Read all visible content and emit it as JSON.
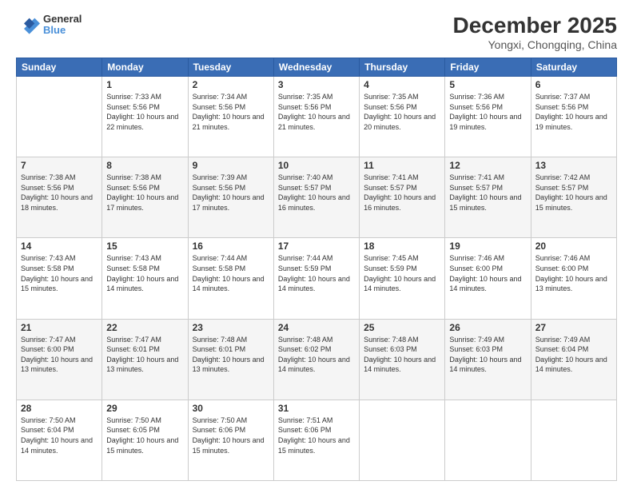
{
  "header": {
    "logo": {
      "line1": "General",
      "line2": "Blue"
    },
    "title": "December 2025",
    "location": "Yongxi, Chongqing, China"
  },
  "weekdays": [
    "Sunday",
    "Monday",
    "Tuesday",
    "Wednesday",
    "Thursday",
    "Friday",
    "Saturday"
  ],
  "weeks": [
    [
      {
        "date": "",
        "sunrise": "",
        "sunset": "",
        "daylight": ""
      },
      {
        "date": "1",
        "sunrise": "Sunrise: 7:33 AM",
        "sunset": "Sunset: 5:56 PM",
        "daylight": "Daylight: 10 hours and 22 minutes."
      },
      {
        "date": "2",
        "sunrise": "Sunrise: 7:34 AM",
        "sunset": "Sunset: 5:56 PM",
        "daylight": "Daylight: 10 hours and 21 minutes."
      },
      {
        "date": "3",
        "sunrise": "Sunrise: 7:35 AM",
        "sunset": "Sunset: 5:56 PM",
        "daylight": "Daylight: 10 hours and 21 minutes."
      },
      {
        "date": "4",
        "sunrise": "Sunrise: 7:35 AM",
        "sunset": "Sunset: 5:56 PM",
        "daylight": "Daylight: 10 hours and 20 minutes."
      },
      {
        "date": "5",
        "sunrise": "Sunrise: 7:36 AM",
        "sunset": "Sunset: 5:56 PM",
        "daylight": "Daylight: 10 hours and 19 minutes."
      },
      {
        "date": "6",
        "sunrise": "Sunrise: 7:37 AM",
        "sunset": "Sunset: 5:56 PM",
        "daylight": "Daylight: 10 hours and 19 minutes."
      }
    ],
    [
      {
        "date": "7",
        "sunrise": "Sunrise: 7:38 AM",
        "sunset": "Sunset: 5:56 PM",
        "daylight": "Daylight: 10 hours and 18 minutes."
      },
      {
        "date": "8",
        "sunrise": "Sunrise: 7:38 AM",
        "sunset": "Sunset: 5:56 PM",
        "daylight": "Daylight: 10 hours and 17 minutes."
      },
      {
        "date": "9",
        "sunrise": "Sunrise: 7:39 AM",
        "sunset": "Sunset: 5:56 PM",
        "daylight": "Daylight: 10 hours and 17 minutes."
      },
      {
        "date": "10",
        "sunrise": "Sunrise: 7:40 AM",
        "sunset": "Sunset: 5:57 PM",
        "daylight": "Daylight: 10 hours and 16 minutes."
      },
      {
        "date": "11",
        "sunrise": "Sunrise: 7:41 AM",
        "sunset": "Sunset: 5:57 PM",
        "daylight": "Daylight: 10 hours and 16 minutes."
      },
      {
        "date": "12",
        "sunrise": "Sunrise: 7:41 AM",
        "sunset": "Sunset: 5:57 PM",
        "daylight": "Daylight: 10 hours and 15 minutes."
      },
      {
        "date": "13",
        "sunrise": "Sunrise: 7:42 AM",
        "sunset": "Sunset: 5:57 PM",
        "daylight": "Daylight: 10 hours and 15 minutes."
      }
    ],
    [
      {
        "date": "14",
        "sunrise": "Sunrise: 7:43 AM",
        "sunset": "Sunset: 5:58 PM",
        "daylight": "Daylight: 10 hours and 15 minutes."
      },
      {
        "date": "15",
        "sunrise": "Sunrise: 7:43 AM",
        "sunset": "Sunset: 5:58 PM",
        "daylight": "Daylight: 10 hours and 14 minutes."
      },
      {
        "date": "16",
        "sunrise": "Sunrise: 7:44 AM",
        "sunset": "Sunset: 5:58 PM",
        "daylight": "Daylight: 10 hours and 14 minutes."
      },
      {
        "date": "17",
        "sunrise": "Sunrise: 7:44 AM",
        "sunset": "Sunset: 5:59 PM",
        "daylight": "Daylight: 10 hours and 14 minutes."
      },
      {
        "date": "18",
        "sunrise": "Sunrise: 7:45 AM",
        "sunset": "Sunset: 5:59 PM",
        "daylight": "Daylight: 10 hours and 14 minutes."
      },
      {
        "date": "19",
        "sunrise": "Sunrise: 7:46 AM",
        "sunset": "Sunset: 6:00 PM",
        "daylight": "Daylight: 10 hours and 14 minutes."
      },
      {
        "date": "20",
        "sunrise": "Sunrise: 7:46 AM",
        "sunset": "Sunset: 6:00 PM",
        "daylight": "Daylight: 10 hours and 13 minutes."
      }
    ],
    [
      {
        "date": "21",
        "sunrise": "Sunrise: 7:47 AM",
        "sunset": "Sunset: 6:00 PM",
        "daylight": "Daylight: 10 hours and 13 minutes."
      },
      {
        "date": "22",
        "sunrise": "Sunrise: 7:47 AM",
        "sunset": "Sunset: 6:01 PM",
        "daylight": "Daylight: 10 hours and 13 minutes."
      },
      {
        "date": "23",
        "sunrise": "Sunrise: 7:48 AM",
        "sunset": "Sunset: 6:01 PM",
        "daylight": "Daylight: 10 hours and 13 minutes."
      },
      {
        "date": "24",
        "sunrise": "Sunrise: 7:48 AM",
        "sunset": "Sunset: 6:02 PM",
        "daylight": "Daylight: 10 hours and 14 minutes."
      },
      {
        "date": "25",
        "sunrise": "Sunrise: 7:48 AM",
        "sunset": "Sunset: 6:03 PM",
        "daylight": "Daylight: 10 hours and 14 minutes."
      },
      {
        "date": "26",
        "sunrise": "Sunrise: 7:49 AM",
        "sunset": "Sunset: 6:03 PM",
        "daylight": "Daylight: 10 hours and 14 minutes."
      },
      {
        "date": "27",
        "sunrise": "Sunrise: 7:49 AM",
        "sunset": "Sunset: 6:04 PM",
        "daylight": "Daylight: 10 hours and 14 minutes."
      }
    ],
    [
      {
        "date": "28",
        "sunrise": "Sunrise: 7:50 AM",
        "sunset": "Sunset: 6:04 PM",
        "daylight": "Daylight: 10 hours and 14 minutes."
      },
      {
        "date": "29",
        "sunrise": "Sunrise: 7:50 AM",
        "sunset": "Sunset: 6:05 PM",
        "daylight": "Daylight: 10 hours and 15 minutes."
      },
      {
        "date": "30",
        "sunrise": "Sunrise: 7:50 AM",
        "sunset": "Sunset: 6:06 PM",
        "daylight": "Daylight: 10 hours and 15 minutes."
      },
      {
        "date": "31",
        "sunrise": "Sunrise: 7:51 AM",
        "sunset": "Sunset: 6:06 PM",
        "daylight": "Daylight: 10 hours and 15 minutes."
      },
      {
        "date": "",
        "sunrise": "",
        "sunset": "",
        "daylight": ""
      },
      {
        "date": "",
        "sunrise": "",
        "sunset": "",
        "daylight": ""
      },
      {
        "date": "",
        "sunrise": "",
        "sunset": "",
        "daylight": ""
      }
    ]
  ]
}
